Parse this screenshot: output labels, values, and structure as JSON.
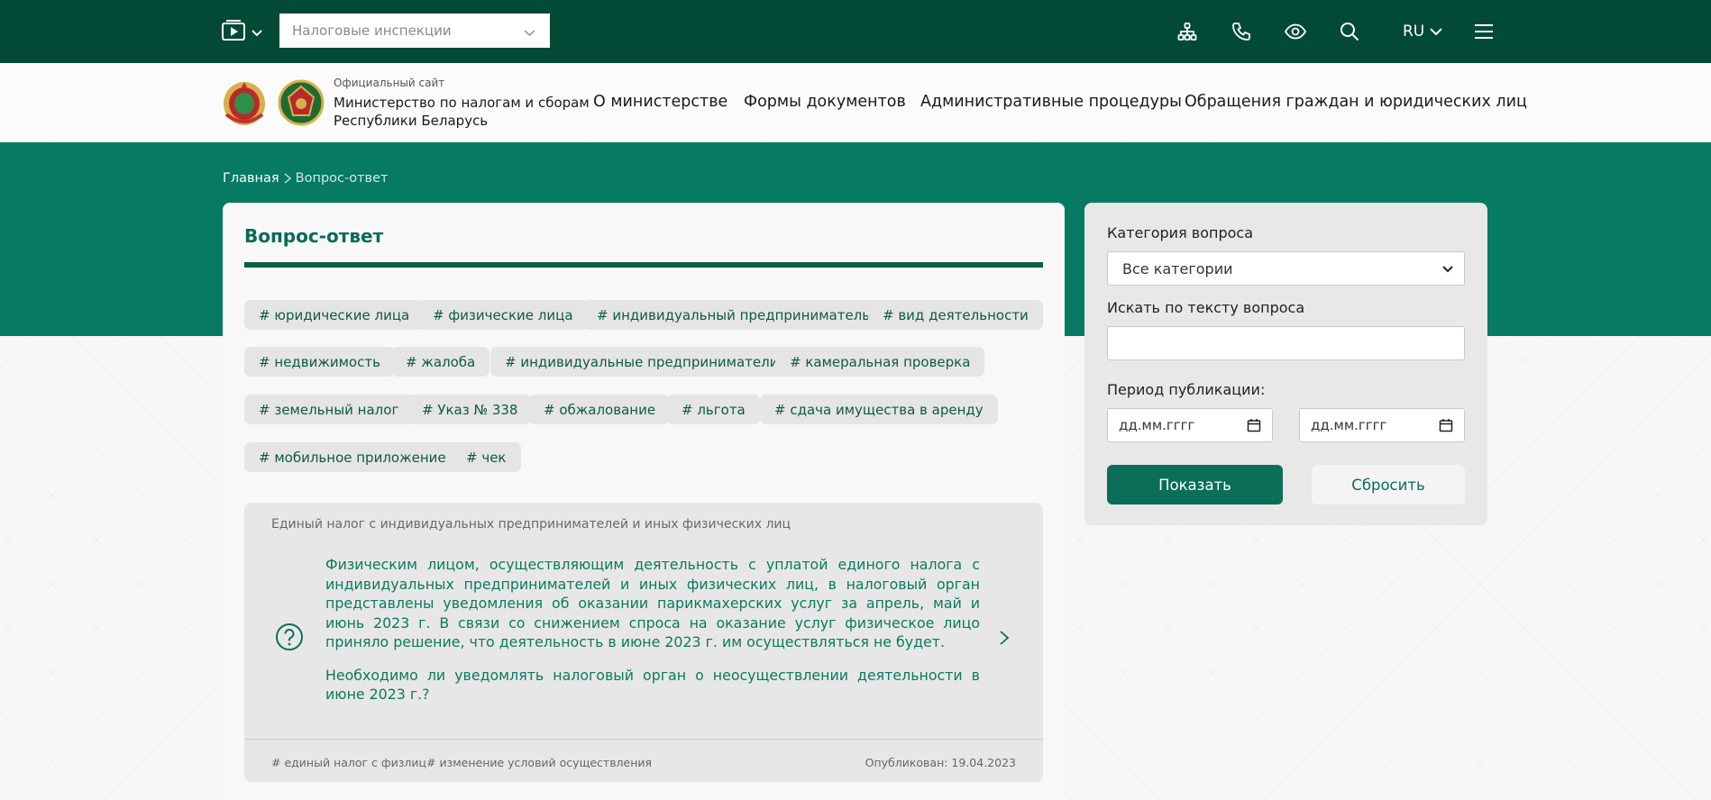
{
  "topbar": {
    "inspections_select": "Налоговые инспекции",
    "language": "RU",
    "icons": [
      "sitemap-icon",
      "phone-icon",
      "eye-icon",
      "search-icon",
      "menu-icon"
    ]
  },
  "header": {
    "site_caption": "Официальный сайт",
    "site_name_line1": "Министерство по налогам и сборам",
    "site_name_line2": "Республики Беларусь",
    "nav": [
      "О министерстве",
      "Формы документов",
      "Административные процедуры",
      "Обращения граждан и юридических лиц"
    ]
  },
  "breadcrumb": {
    "home": "Главная",
    "current": "Вопрос-ответ"
  },
  "main": {
    "title": "Вопрос-ответ",
    "tags": [
      "# юридические лица",
      "# физические лица",
      "# индивидуальный предприниматель",
      "# вид деятельности",
      "# недвижимость",
      "# жалоба",
      "# индивидуальные предприниматели",
      "# камеральная проверка",
      "# земельный налог",
      "# Указ № 338",
      "# обжалование",
      "# льгота",
      "# сдача имущества в аренду",
      "# мобильное приложение",
      "# чек"
    ]
  },
  "qa": {
    "category": "Единый налог с индивидуальных предпринимателей и иных физических лиц",
    "paragraph1": "Физическим лицом, осуществляющим деятельность с уплатой единого налога с индивидуальных предпринимателей и иных физических лиц, в налоговый орган представлены уведомления об оказании парикмахерских услуг за апрель, май и июнь 2023 г. В связи со снижением спроса на оказание услуг физическое лицо приняло решение, что деятельность в июне 2023 г. им осуществляться не будет.",
    "paragraph2": "Необходимо ли уведомлять налоговый орган о неосуществлении деятельности в июне 2023 г.?",
    "tags": [
      "# единый налог с физлиц",
      "# изменение условий осуществления"
    ],
    "published": "Опубликован: 19.04.2023"
  },
  "filter": {
    "category_label": "Категория вопроса",
    "category_value": "Все категории",
    "search_label": "Искать по тексту вопроса",
    "search_value": "",
    "period_label": "Период публикации:",
    "date_placeholder_from": "дд.мм.гггг",
    "date_placeholder_to": "дд.мм.гггг",
    "show_button": "Показать",
    "reset_button": "Сбросить"
  },
  "colors": {
    "topbar": "#024a35",
    "band": "#077a62",
    "accent": "#0a6e58",
    "question_text": "#0b7a5f"
  }
}
